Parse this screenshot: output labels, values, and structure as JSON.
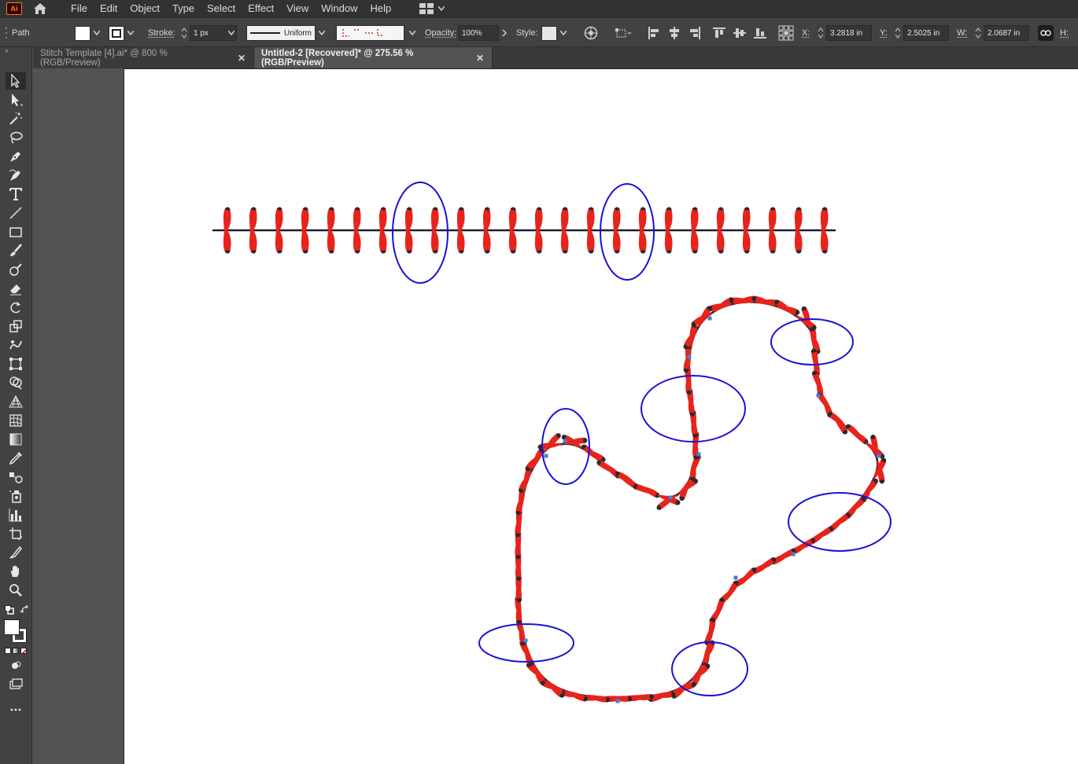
{
  "app": {
    "logo": "Ai"
  },
  "menu": [
    "File",
    "Edit",
    "Object",
    "Type",
    "Select",
    "Effect",
    "View",
    "Window",
    "Help"
  ],
  "control": {
    "object_type": "Path",
    "stroke_label": "Stroke:",
    "stroke_weight": "1 px",
    "stroke_profile": "Uniform",
    "opacity_label": "Opacity:",
    "opacity_value": "100%",
    "style_label": "Style:",
    "x_label": "X:",
    "x_value": "3.2818 in",
    "y_label": "Y:",
    "y_value": "2.5025 in",
    "w_label": "W:",
    "w_value": "2.0687 in",
    "h_label": "H:"
  },
  "tabs": [
    {
      "label": "Stitch Template [4].ai* @ 800 % (RGB/Preview)",
      "active": false
    },
    {
      "label": "Untitled-2 [Recovered]* @ 275.56 % (RGB/Preview)",
      "active": true
    }
  ],
  "colors": {
    "stitch_red": "#e8231c",
    "stitch_dark": "#2a2a2a",
    "path": "#1c1c2e",
    "highlight": "#1a12d6",
    "anchor": "#4a7cd6"
  }
}
